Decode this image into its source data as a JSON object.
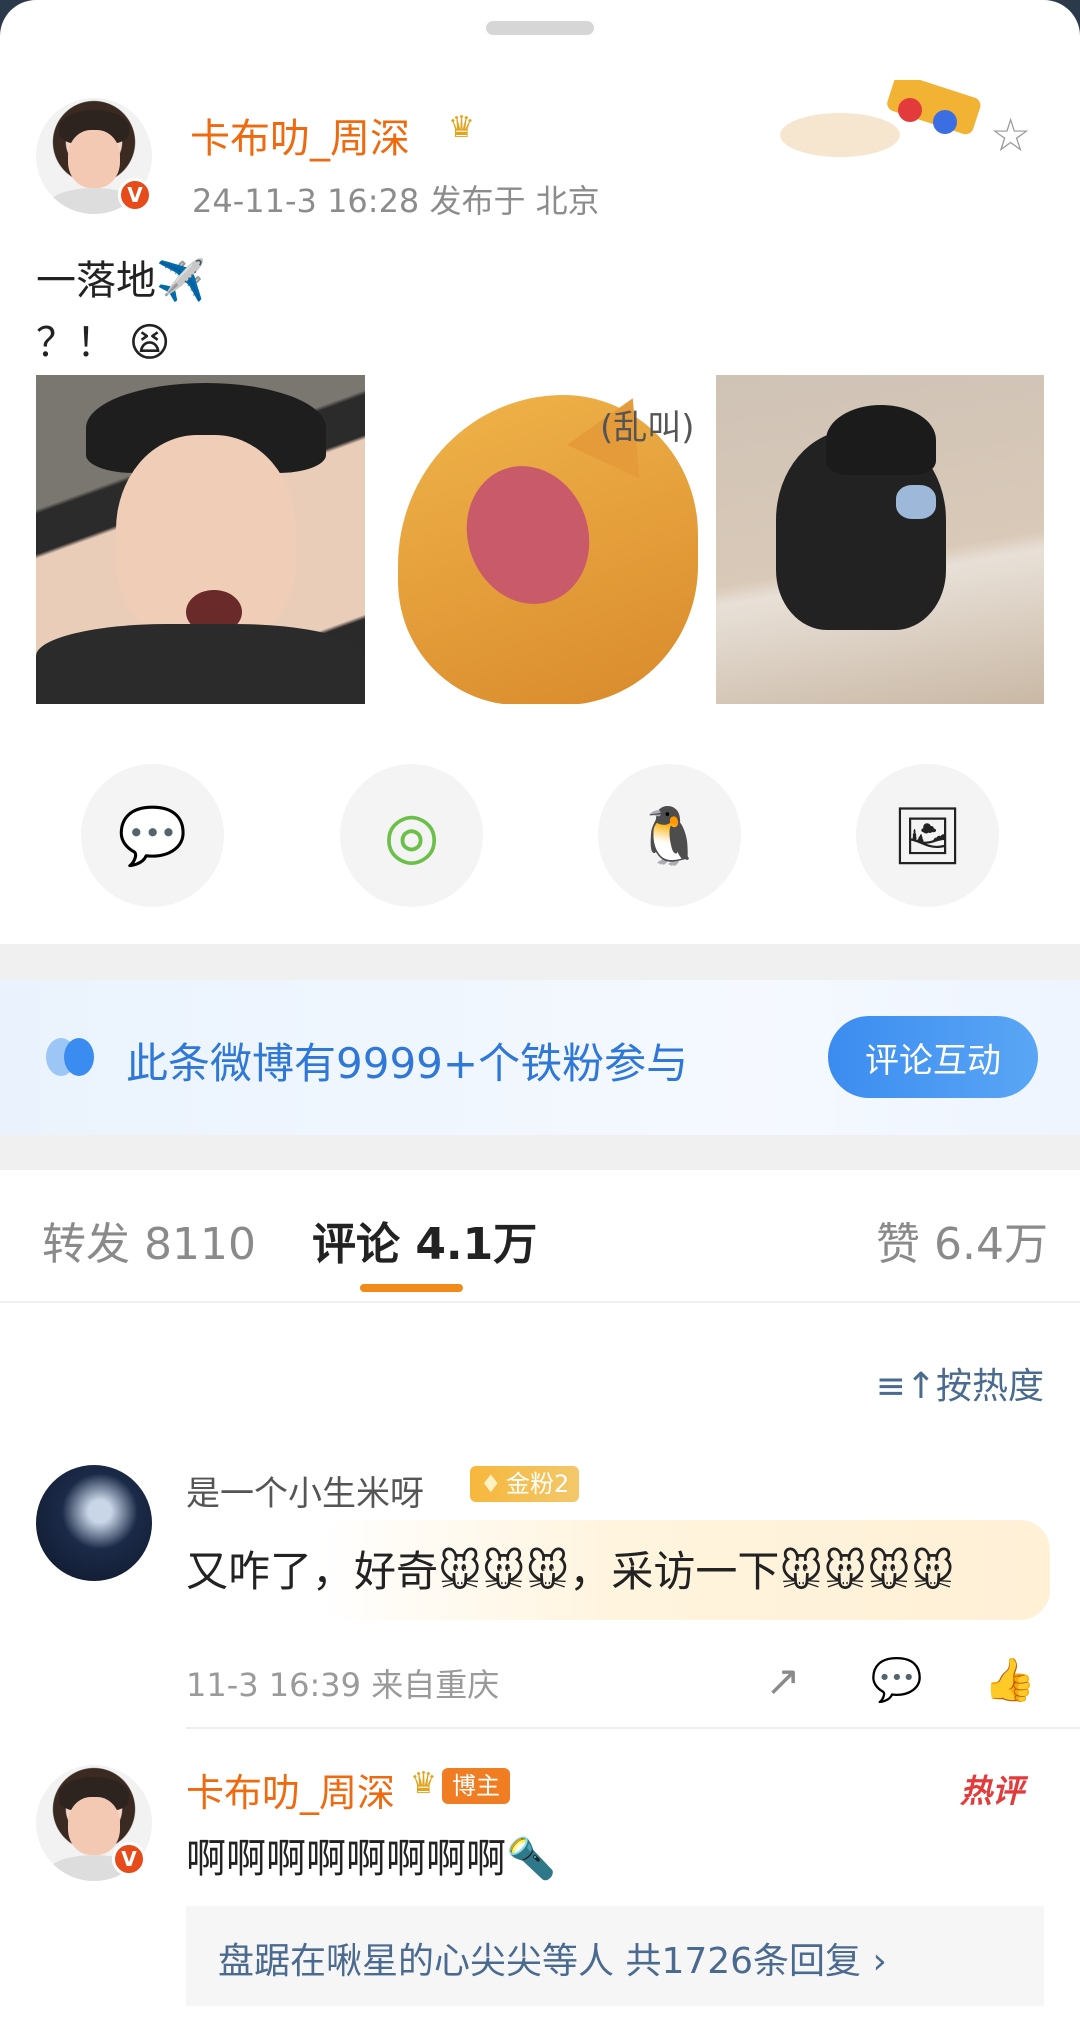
{
  "post": {
    "author": "卡布叻_周深",
    "meta": "24-11-3 16:28  发布于 北京",
    "line1": "一落地✈️",
    "line2": "？！ 😫",
    "cat_caption": "(乱叫)",
    "verified": "V",
    "crown": "♛"
  },
  "share": {
    "items": [
      {
        "name": "wechat",
        "icon": "💬",
        "color": "#3fc08a"
      },
      {
        "name": "moments",
        "icon": "◎",
        "color": "#6cc04a"
      },
      {
        "name": "qq",
        "icon": "🐧",
        "color": "#2aa7e2"
      },
      {
        "name": "save-image",
        "icon": "🖼",
        "color": "#f5a623"
      }
    ]
  },
  "fans": {
    "text": "此条微博有9999+个铁粉参与",
    "button": "评论互动"
  },
  "tabs": {
    "repost": "转发 8110",
    "comments": "评论 4.1万",
    "likes": "赞 6.4万"
  },
  "sort": {
    "label": "≡↑按热度"
  },
  "comment1": {
    "name": "是一个小生米呀",
    "badge": "金粉2",
    "text": "又咋了，好奇🐭🐭🐭，采访一下🐭🐭🐭🐭",
    "meta": "11-3 16:39  来自重庆",
    "icons": {
      "share": "↗",
      "reply": "💬",
      "like": "👍"
    }
  },
  "comment2": {
    "name": "卡布叻_周深",
    "badge": "博主",
    "hot": "热评",
    "text": "啊啊啊啊啊啊啊啊🔦",
    "reply": "盘踞在啾星的心尖尖等人  共1726条回复 ›"
  }
}
